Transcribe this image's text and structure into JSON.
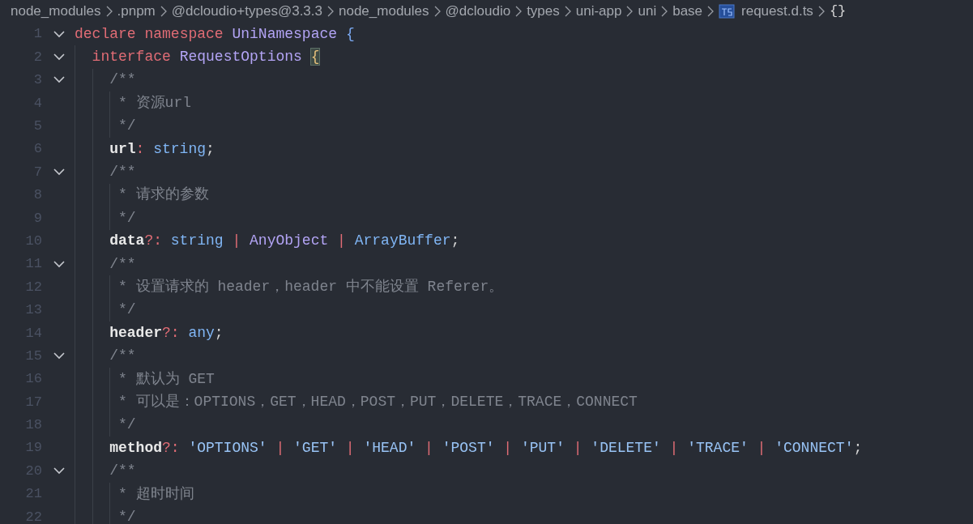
{
  "breadcrumbs": [
    {
      "kind": "folder",
      "label": "node_modules"
    },
    {
      "kind": "folder",
      "label": ".pnpm"
    },
    {
      "kind": "folder",
      "label": "@dcloudio+types@3.3.3"
    },
    {
      "kind": "folder",
      "label": "node_modules"
    },
    {
      "kind": "folder",
      "label": "@dcloudio"
    },
    {
      "kind": "folder",
      "label": "types"
    },
    {
      "kind": "folder",
      "label": "uni-app"
    },
    {
      "kind": "folder",
      "label": "uni"
    },
    {
      "kind": "folder",
      "label": "base"
    },
    {
      "kind": "file",
      "label": "request.d.ts"
    },
    {
      "kind": "symbol",
      "label": "{}"
    }
  ],
  "lines": [
    {
      "number": "1",
      "expanded": true,
      "tokens": [
        {
          "kind": "kw",
          "text": "declare "
        },
        {
          "kind": "kw",
          "text": "namespace "
        },
        {
          "kind": "type",
          "text": "UniNamespace "
        },
        {
          "kind": "brace",
          "text": "{"
        }
      ],
      "children": [
        {
          "number": "2",
          "expanded": true,
          "tokens": [
            {
              "kind": "kw",
              "text": "interface "
            },
            {
              "kind": "type",
              "text": "RequestOptions "
            },
            {
              "kind": "brace_match",
              "text": "{"
            }
          ],
          "children": [
            {
              "number": "3",
              "expanded": true,
              "kind": "comment_start",
              "tokens": [
                {
                  "kind": "comment",
                  "text": "/**"
                }
              ],
              "children": [
                {
                  "number": "4",
                  "tokens": [
                    {
                      "kind": "comment",
                      "text": "* 资源url"
                    }
                  ]
                },
                {
                  "number": "5",
                  "tokens": [
                    {
                      "kind": "comment",
                      "text": "*/"
                    }
                  ]
                }
              ]
            },
            {
              "number": "6",
              "tokens": [
                {
                  "kind": "prop",
                  "text": "url"
                },
                {
                  "kind": "punct",
                  "text": ": "
                },
                {
                  "kind": "prim",
                  "text": "string"
                },
                {
                  "kind": "plain",
                  "text": ";"
                }
              ]
            },
            {
              "number": "7",
              "expanded": true,
              "kind": "comment_start",
              "tokens": [
                {
                  "kind": "comment",
                  "text": "/**"
                }
              ],
              "children": [
                {
                  "number": "8",
                  "tokens": [
                    {
                      "kind": "comment",
                      "text": "* 请求的参数"
                    }
                  ]
                },
                {
                  "number": "9",
                  "tokens": [
                    {
                      "kind": "comment",
                      "text": "*/"
                    }
                  ]
                }
              ]
            },
            {
              "number": "10",
              "tokens": [
                {
                  "kind": "prop",
                  "text": "data"
                },
                {
                  "kind": "punct",
                  "text": "?: "
                },
                {
                  "kind": "prim",
                  "text": "string "
                },
                {
                  "kind": "punct",
                  "text": "| "
                },
                {
                  "kind": "type",
                  "text": "AnyObject "
                },
                {
                  "kind": "punct",
                  "text": "| "
                },
                {
                  "kind": "prim",
                  "text": "ArrayBuffer"
                },
                {
                  "kind": "plain",
                  "text": ";"
                }
              ]
            },
            {
              "number": "11",
              "expanded": true,
              "kind": "comment_start",
              "tokens": [
                {
                  "kind": "comment",
                  "text": "/**"
                }
              ],
              "children": [
                {
                  "number": "12",
                  "tokens": [
                    {
                      "kind": "comment",
                      "text": "* 设置请求的 header，header 中不能设置 Referer。"
                    }
                  ]
                },
                {
                  "number": "13",
                  "tokens": [
                    {
                      "kind": "comment",
                      "text": "*/"
                    }
                  ]
                }
              ]
            },
            {
              "number": "14",
              "tokens": [
                {
                  "kind": "prop",
                  "text": "header"
                },
                {
                  "kind": "punct",
                  "text": "?: "
                },
                {
                  "kind": "prim",
                  "text": "any"
                },
                {
                  "kind": "plain",
                  "text": ";"
                }
              ]
            },
            {
              "number": "15",
              "expanded": true,
              "kind": "comment_start",
              "tokens": [
                {
                  "kind": "comment",
                  "text": "/**"
                }
              ],
              "children": [
                {
                  "number": "16",
                  "tokens": [
                    {
                      "kind": "comment",
                      "text": "* 默认为 GET"
                    }
                  ]
                },
                {
                  "number": "17",
                  "tokens": [
                    {
                      "kind": "comment",
                      "text": "* 可以是：OPTIONS，GET，HEAD，POST，PUT，DELETE，TRACE，CONNECT"
                    }
                  ]
                },
                {
                  "number": "18",
                  "tokens": [
                    {
                      "kind": "comment",
                      "text": "*/"
                    }
                  ]
                }
              ]
            },
            {
              "number": "19",
              "tokens": [
                {
                  "kind": "prop",
                  "text": "method"
                },
                {
                  "kind": "punct",
                  "text": "?: "
                },
                {
                  "kind": "string",
                  "text": "'OPTIONS' "
                },
                {
                  "kind": "punct",
                  "text": "| "
                },
                {
                  "kind": "string",
                  "text": "'GET' "
                },
                {
                  "kind": "punct",
                  "text": "| "
                },
                {
                  "kind": "string",
                  "text": "'HEAD' "
                },
                {
                  "kind": "punct",
                  "text": "| "
                },
                {
                  "kind": "string",
                  "text": "'POST' "
                },
                {
                  "kind": "punct",
                  "text": "| "
                },
                {
                  "kind": "string",
                  "text": "'PUT' "
                },
                {
                  "kind": "punct",
                  "text": "| "
                },
                {
                  "kind": "string",
                  "text": "'DELETE' "
                },
                {
                  "kind": "punct",
                  "text": "| "
                },
                {
                  "kind": "string",
                  "text": "'TRACE' "
                },
                {
                  "kind": "punct",
                  "text": "| "
                },
                {
                  "kind": "string",
                  "text": "'CONNECT'"
                },
                {
                  "kind": "plain",
                  "text": ";"
                }
              ]
            },
            {
              "number": "20",
              "expanded": true,
              "kind": "comment_start",
              "tokens": [
                {
                  "kind": "comment",
                  "text": "/**"
                }
              ],
              "children": [
                {
                  "number": "21",
                  "tokens": [
                    {
                      "kind": "comment",
                      "text": "* 超时时间"
                    }
                  ]
                },
                {
                  "number": "22",
                  "tokens": [
                    {
                      "kind": "comment",
                      "text": "*/"
                    }
                  ]
                }
              ]
            }
          ]
        }
      ]
    }
  ]
}
